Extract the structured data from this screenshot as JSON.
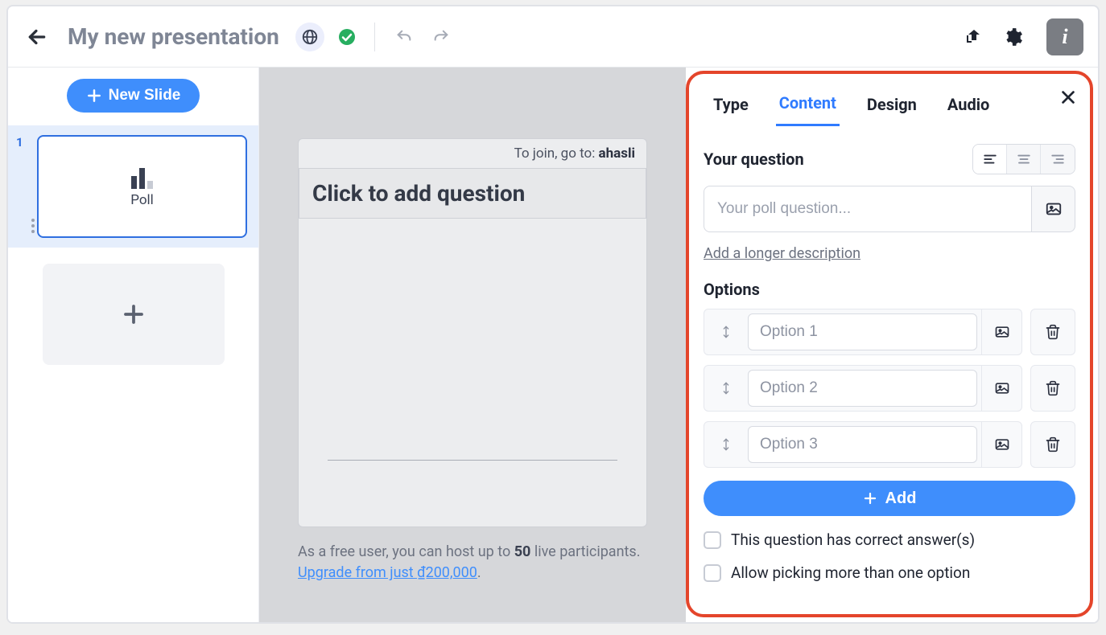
{
  "header": {
    "title": "My new presentation"
  },
  "sidebar": {
    "new_slide_label": "New Slide",
    "slide_number": "1",
    "slide_type_label": "Poll"
  },
  "canvas": {
    "join_prefix": "To join, go to: ",
    "join_domain": "ahasli",
    "question_placeholder": "Click to add question",
    "upsell_prefix": "As a free user, you can host up to ",
    "upsell_limit": "50",
    "upsell_suffix": " live participants.  ",
    "upgrade_text": "Upgrade from just ₫200,000",
    "upsell_end": "."
  },
  "panel": {
    "tabs": {
      "type": "Type",
      "content": "Content",
      "design": "Design",
      "audio": "Audio"
    },
    "question_label": "Your question",
    "question_placeholder": "Your poll question...",
    "description_link": "Add a longer description",
    "options_label": "Options",
    "options": [
      {
        "placeholder": "Option 1"
      },
      {
        "placeholder": "Option 2"
      },
      {
        "placeholder": "Option 3"
      }
    ],
    "add_label": "Add",
    "checkbox_correct": "This question has correct answer(s)",
    "checkbox_multi": "Allow picking more than one option"
  }
}
